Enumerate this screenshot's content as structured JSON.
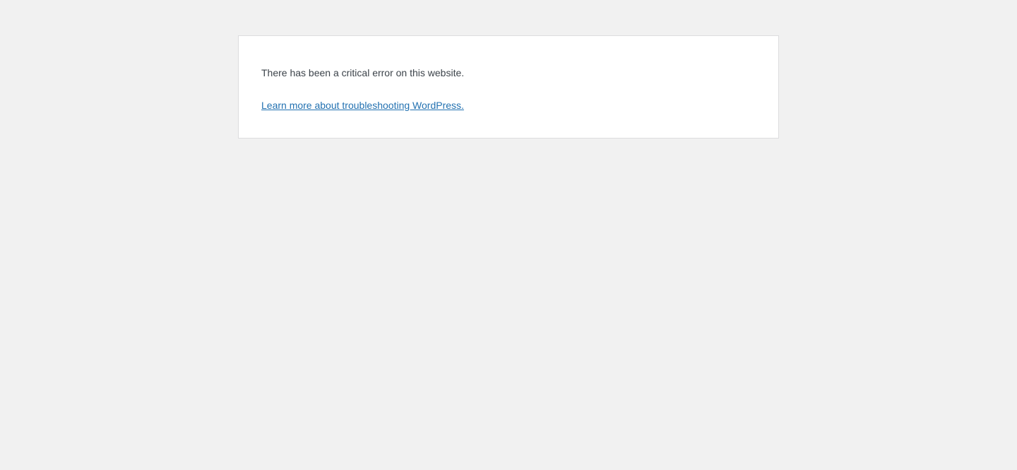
{
  "error_page": {
    "message": "There has been a critical error on this website.",
    "help_link_text": "Learn more about troubleshooting WordPress."
  },
  "colors": {
    "page_background": "#f1f1f1",
    "box_background": "#ffffff",
    "box_border": "#dcdcde",
    "text": "#3c434a",
    "link": "#2271b1"
  }
}
